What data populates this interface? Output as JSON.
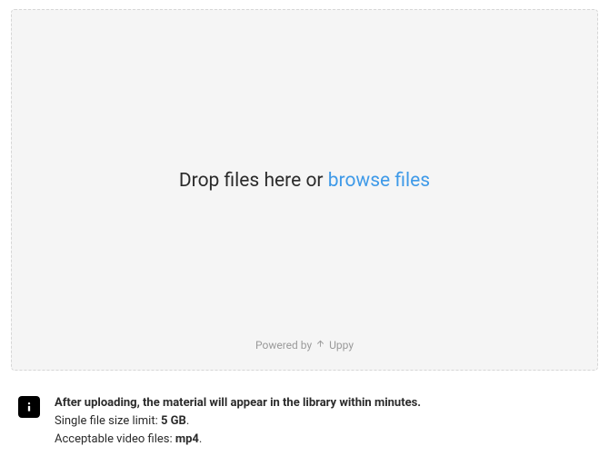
{
  "dropzone": {
    "instruction_prefix": "Drop files here or ",
    "browse_label": "browse files",
    "powered_prefix": "Powered by ",
    "powered_name": "Uppy"
  },
  "info": {
    "line1": "After uploading, the material will appear in the library within minutes.",
    "line2_prefix": "Single file size limit: ",
    "size_limit": "5 GB",
    "line2_suffix": ".",
    "line3_prefix": "Acceptable video files: ",
    "video_formats": "mp4",
    "line3_suffix": "."
  }
}
